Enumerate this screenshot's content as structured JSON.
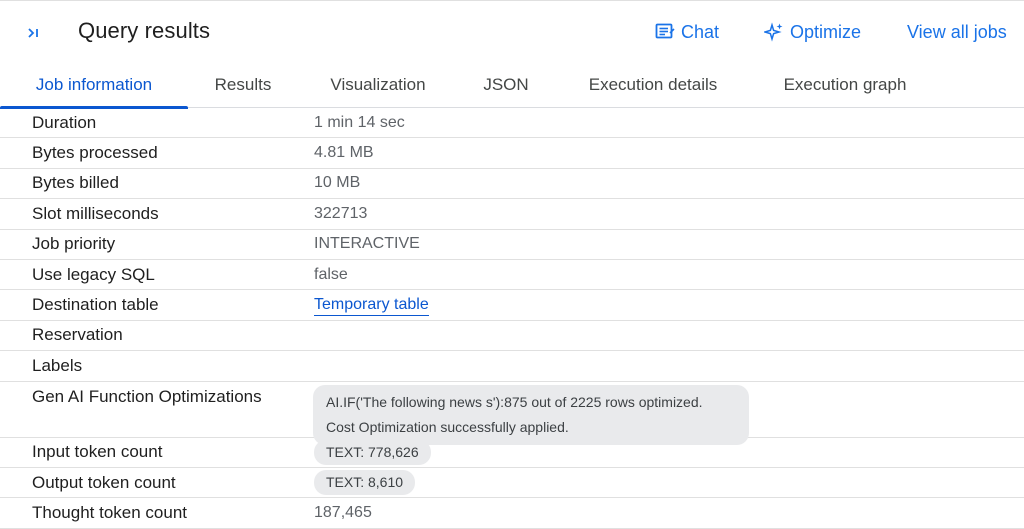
{
  "header": {
    "collapse_icon": ">|",
    "title": "Query results",
    "chat_label": "Chat",
    "optimize_label": "Optimize",
    "view_all_label": "View all jobs",
    "accent_color": "#1a73e8"
  },
  "tabs": [
    {
      "label": "Job information",
      "active": true
    },
    {
      "label": "Results"
    },
    {
      "label": "Visualization"
    },
    {
      "label": "JSON"
    },
    {
      "label": "Execution details"
    },
    {
      "label": "Execution graph"
    }
  ],
  "job_info": {
    "duration": {
      "key": "Duration",
      "value": "1 min 14 sec"
    },
    "bytes_processed": {
      "key": "Bytes processed",
      "value": "4.81 MB"
    },
    "bytes_billed": {
      "key": "Bytes billed",
      "value": "10 MB"
    },
    "slot_ms": {
      "key": "Slot milliseconds",
      "value": "322713"
    },
    "job_priority": {
      "key": "Job priority",
      "value": "INTERACTIVE"
    },
    "legacy_sql": {
      "key": "Use legacy SQL",
      "value": "false"
    },
    "destination_table": {
      "key": "Destination table",
      "value": "Temporary table"
    },
    "reservation": {
      "key": "Reservation",
      "value": ""
    },
    "labels": {
      "key": "Labels",
      "value": ""
    },
    "gen_ai": {
      "key": "Gen AI Function Optimizations",
      "line1": "AI.IF('The following news s'):875 out of 2225 rows optimized.",
      "line2": "Cost Optimization successfully applied."
    },
    "input_tokens": {
      "key": "Input token count",
      "value": "TEXT: 778,626"
    },
    "output_tokens": {
      "key": "Output token count",
      "value": "TEXT: 8,610"
    },
    "thought_tokens": {
      "key": "Thought token count",
      "value": "187,465"
    }
  }
}
